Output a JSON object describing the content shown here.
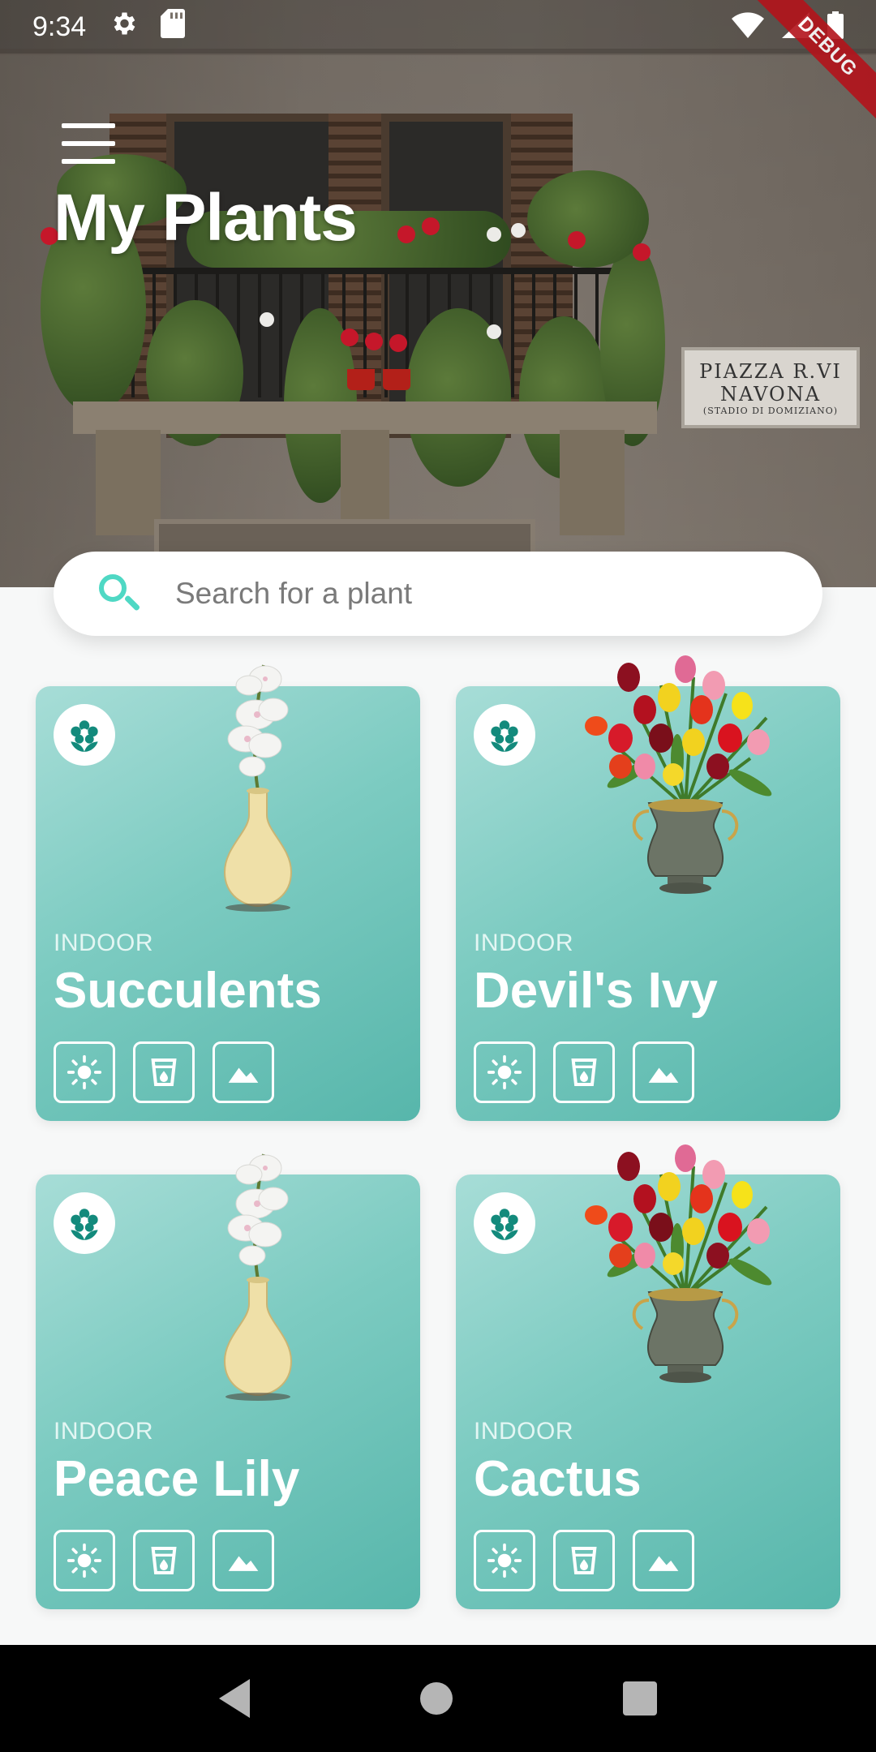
{
  "status_bar": {
    "time": "9:34",
    "settings_icon": "gear-icon",
    "sd_icon": "sd-card-icon",
    "wifi_icon": "wifi-icon",
    "signal_icon": "signal-icon",
    "battery_icon": "battery-icon",
    "debug_label": "DEBUG"
  },
  "header": {
    "title": "My Plants",
    "menu_icon": "hamburger-menu-icon",
    "sign": {
      "line1": "PIAZZA R.VI",
      "line2": "NAVONA",
      "line3": "(STADIO DI DOMIZIANO)"
    }
  },
  "search": {
    "placeholder": "Search for a plant",
    "value": "",
    "icon": "search-icon"
  },
  "cards": [
    {
      "category": "INDOOR",
      "name": "Succulents",
      "image": "white-orchid-vase",
      "badge_icon": "flower-icon",
      "features": [
        "sun-icon",
        "water-cup-icon",
        "terrain-icon"
      ]
    },
    {
      "category": "INDOOR",
      "name": "Devil's Ivy",
      "image": "tulip-bouquet-vase",
      "badge_icon": "flower-icon",
      "features": [
        "sun-icon",
        "water-cup-icon",
        "terrain-icon"
      ]
    },
    {
      "category": "INDOOR",
      "name": "Peace Lily",
      "image": "white-orchid-vase",
      "badge_icon": "flower-icon",
      "features": [
        "sun-icon",
        "water-cup-icon",
        "terrain-icon"
      ]
    },
    {
      "category": "INDOOR",
      "name": "Cactus",
      "image": "tulip-bouquet-vase",
      "badge_icon": "flower-icon",
      "features": [
        "sun-icon",
        "water-cup-icon",
        "terrain-icon"
      ]
    }
  ],
  "colors": {
    "accent": "#4fd8c4",
    "card_gradient_start": "#a7ddd7",
    "card_gradient_end": "#57b6ab",
    "badge_icon": "#138a7c"
  },
  "nav_bar": {
    "back_icon": "back-triangle-icon",
    "home_icon": "home-circle-icon",
    "recents_icon": "recents-square-icon"
  }
}
